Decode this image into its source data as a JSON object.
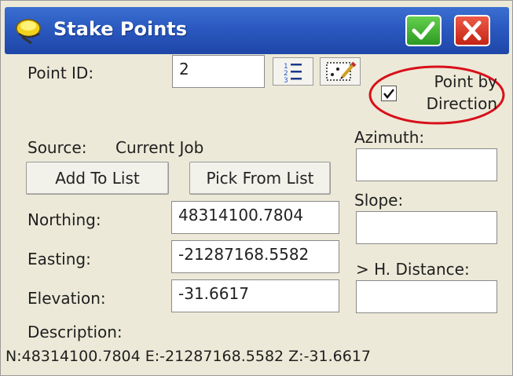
{
  "window": {
    "title": "Stake Points",
    "ok_icon": "checkmark-icon",
    "close_icon": "close-icon",
    "accent": "#2a59c0"
  },
  "form": {
    "point_id_label": "Point ID:",
    "point_id_value": "2",
    "list_icon": "list-icon",
    "map_icon": "map-edit-icon",
    "point_by_direction_label": "Point by Direction",
    "point_by_direction_checked": true,
    "source_label": "Source:",
    "source_value": "Current Job",
    "add_to_list_label": "Add To List",
    "pick_from_list_label": "Pick From List",
    "northing_label": "Northing:",
    "northing_value": "48314100.7804",
    "easting_label": "Easting:",
    "easting_value": "-21287168.5582",
    "elevation_label": "Elevation:",
    "elevation_value": "-31.6617",
    "azimuth_label": "Azimuth:",
    "azimuth_value": "",
    "slope_label": "Slope:",
    "slope_value": "",
    "h_distance_label": "> H. Distance:",
    "h_distance_value": "",
    "description_label": "Description:",
    "summary": "N:48314100.7804 E:-21287168.5582 Z:-31.6617"
  },
  "annotation_color": "#d8101a"
}
